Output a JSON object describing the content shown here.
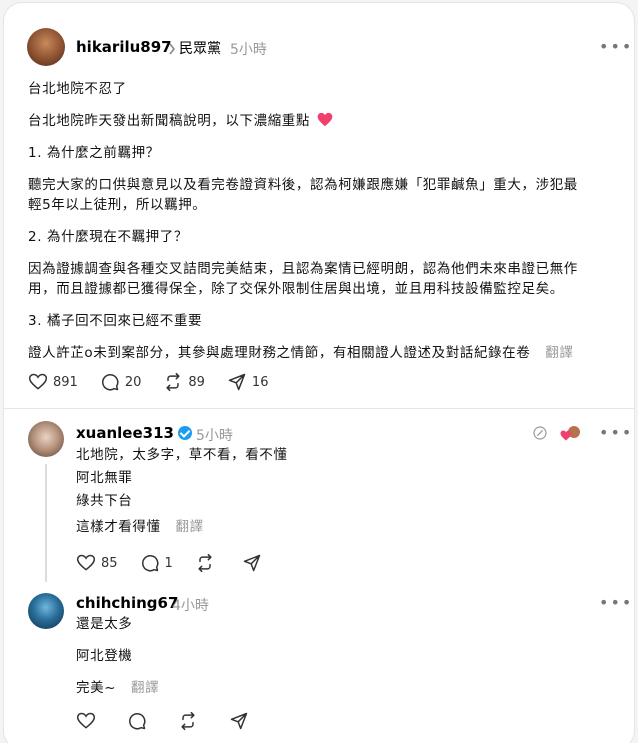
{
  "main_post": {
    "username": "hikarilu897",
    "community": "民眾黨",
    "time": "5小時",
    "paragraphs": [
      "台北地院不忍了",
      "台北地院昨天發出新聞稿說明，以下濃縮重點",
      "1. 為什麼之前羈押？",
      "聽完大家的口供與意見以及看完卷證資料後，認為柯嫌跟應嫌「犯罪鹹魚」重大，涉犯最",
      "輕5年以上徒刑，所以羈押。",
      "2. 為什麼現在不羈押了？",
      "因為證據調查與各種交叉詰問完美結束，且認為案情已經明朗，認為他們未來串證已無作",
      "用，而且證據都已獲得保全，除了交保外限制住居與出境，並且用科技設備監控足矣。",
      "3. 橘子回不回來已經不重要",
      "證人許芷o未到案部分，其參與處理財務之情節，有相關證人證述及對話紀錄在卷"
    ],
    "translate": "翻譯",
    "likes": "891",
    "comments": "20",
    "reposts": "89",
    "shares": "16"
  },
  "reply1": {
    "username": "xuanlee313",
    "time": "5小時",
    "lines": [
      "北地院，太多字，草不看，看不懂",
      "阿北無罪",
      "綠共下台"
    ],
    "extra": "這樣才看得懂",
    "translate": "翻譯",
    "likes": "85",
    "comments": "1"
  },
  "reply2": {
    "username": "chihching67",
    "time": "4小時",
    "lines": [
      "還是太多",
      "阿北登機",
      "完美~"
    ],
    "translate": "翻譯"
  },
  "icons": [
    "heart-icon",
    "comment-icon",
    "repost-icon",
    "share-icon",
    "more-icon",
    "verified-badge-icon",
    "chevron-right-icon",
    "quote-icon"
  ]
}
